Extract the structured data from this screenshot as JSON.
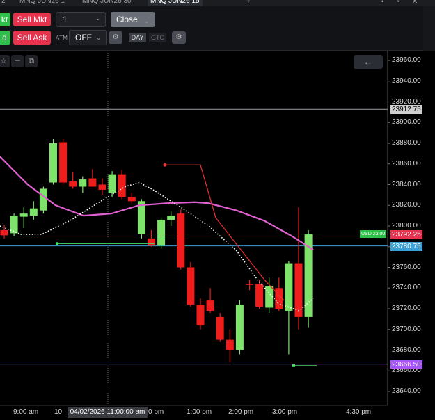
{
  "tabs": [
    {
      "label": "2"
    },
    {
      "label": "MNQ JUN26 1"
    },
    {
      "label": "MNQ JUN26 30"
    },
    {
      "label": "MNQ JUN26 15",
      "active": true
    }
  ],
  "tab_add": "+",
  "toolbar": {
    "buy_mkt": "kt",
    "sell_mkt": "Sell Mkt",
    "quantity": "1",
    "close": "Close",
    "buy_bid": "d",
    "sell_ask": "Sell Ask",
    "atm_label": "ATM",
    "atm_value": "OFF",
    "day": "DAY",
    "gtc": "GTC"
  },
  "chart_data": {
    "type": "candlestick",
    "y_range": [
      23630,
      23975
    ],
    "y_ticks": [
      "23960.00",
      "23940.00",
      "23920.00",
      "23900.00",
      "23880.00",
      "23860.00",
      "23840.00",
      "23820.00",
      "23800.00",
      "23780.00",
      "23760.00",
      "23740.00",
      "23720.00",
      "23700.00",
      "23680.00",
      "23660.00",
      "23640.00"
    ],
    "x_ticks": [
      "9:00 am",
      "10:",
      "0 pm",
      "1:00 pm",
      "2:00 pm",
      "3:00 pm",
      "4:30 pm"
    ],
    "crosshair_time": "04/02/2026 11:00:00 am",
    "price_lines": [
      {
        "label": "23912.75",
        "value": 23912.75,
        "color": "#9aa0a6"
      },
      {
        "label": "23792.25",
        "value": 23792.25,
        "color": "#e5334d"
      },
      {
        "label": "23780.75",
        "value": 23780.75,
        "color": "#3aa0d8"
      },
      {
        "label": "23666.50",
        "value": 23666.5,
        "color": "#a855f7"
      }
    ],
    "position_tag": "USD 23.00",
    "candles": [
      {
        "o": 23796,
        "h": 23801,
        "l": 23788,
        "c": 23791
      },
      {
        "o": 23793,
        "h": 23812,
        "l": 23790,
        "c": 23810
      },
      {
        "o": 23809,
        "h": 23818,
        "l": 23798,
        "c": 23812
      },
      {
        "o": 23810,
        "h": 23824,
        "l": 23806,
        "c": 23817
      },
      {
        "o": 23815,
        "h": 23838,
        "l": 23812,
        "c": 23836
      },
      {
        "o": 23842,
        "h": 23884,
        "l": 23840,
        "c": 23880
      },
      {
        "o": 23881,
        "h": 23884,
        "l": 23840,
        "c": 23842
      },
      {
        "o": 23843,
        "h": 23852,
        "l": 23836,
        "c": 23838
      },
      {
        "o": 23838,
        "h": 23848,
        "l": 23832,
        "c": 23845
      },
      {
        "o": 23846,
        "h": 23855,
        "l": 23838,
        "c": 23838
      },
      {
        "o": 23840,
        "h": 23846,
        "l": 23830,
        "c": 23835
      },
      {
        "o": 23832,
        "h": 23853,
        "l": 23828,
        "c": 23850
      },
      {
        "o": 23850,
        "h": 23854,
        "l": 23826,
        "c": 23828
      },
      {
        "o": 23828,
        "h": 23832,
        "l": 23822,
        "c": 23824
      },
      {
        "o": 23792,
        "h": 23826,
        "l": 23788,
        "c": 23824
      },
      {
        "o": 23788,
        "h": 23796,
        "l": 23780,
        "c": 23781
      },
      {
        "o": 23781,
        "h": 23808,
        "l": 23778,
        "c": 23806
      },
      {
        "o": 23806,
        "h": 23814,
        "l": 23800,
        "c": 23810
      },
      {
        "o": 23812,
        "h": 23816,
        "l": 23758,
        "c": 23760
      },
      {
        "o": 23760,
        "h": 23765,
        "l": 23722,
        "c": 23724
      },
      {
        "o": 23724,
        "h": 23730,
        "l": 23700,
        "c": 23704
      },
      {
        "o": 23728,
        "h": 23740,
        "l": 23716,
        "c": 23718
      },
      {
        "o": 23712,
        "h": 23716,
        "l": 23688,
        "c": 23690
      },
      {
        "o": 23690,
        "h": 23700,
        "l": 23668,
        "c": 23680
      },
      {
        "o": 23680,
        "h": 23728,
        "l": 23676,
        "c": 23724
      },
      {
        "o": 23744,
        "h": 23748,
        "l": 23738,
        "c": 23743
      },
      {
        "o": 23744,
        "h": 23748,
        "l": 23720,
        "c": 23722
      },
      {
        "o": 23721,
        "h": 23750,
        "l": 23716,
        "c": 23742
      },
      {
        "o": 23740,
        "h": 23750,
        "l": 23718,
        "c": 23720
      },
      {
        "o": 23718,
        "h": 23766,
        "l": 23676,
        "c": 23764
      },
      {
        "o": 23764,
        "h": 23818,
        "l": 23700,
        "c": 23712
      },
      {
        "o": 23712,
        "h": 23796,
        "l": 23702,
        "c": 23792
      }
    ],
    "magenta_ma": [
      [
        0,
        23867
      ],
      [
        40,
        23840
      ],
      [
        80,
        23820
      ],
      [
        120,
        23810
      ],
      [
        160,
        23812
      ],
      [
        200,
        23820
      ],
      [
        240,
        23822
      ],
      [
        280,
        23823
      ],
      [
        300,
        23822
      ],
      [
        340,
        23815
      ],
      [
        380,
        23805
      ],
      [
        420,
        23790
      ],
      [
        450,
        23777
      ]
    ],
    "white_dotted_ma": [
      [
        0,
        23800
      ],
      [
        30,
        23792
      ],
      [
        60,
        23792
      ],
      [
        100,
        23805
      ],
      [
        140,
        23822
      ],
      [
        180,
        23838
      ],
      [
        200,
        23842
      ],
      [
        220,
        23835
      ],
      [
        260,
        23818
      ],
      [
        300,
        23800
      ],
      [
        340,
        23776
      ],
      [
        370,
        23748
      ],
      [
        400,
        23725
      ],
      [
        430,
        23718
      ],
      [
        450,
        23730
      ]
    ],
    "red_stops": [
      [
        237,
        23859
      ],
      [
        288,
        23859
      ],
      [
        310,
        23808
      ],
      [
        380,
        23748
      ],
      [
        408,
        23728
      ]
    ],
    "green_targets": [
      [
        82,
        23783
      ],
      [
        222,
        23783
      ],
      [
        422,
        23665
      ],
      [
        455,
        23665
      ]
    ]
  },
  "icons": {
    "tool_1": "star-icon",
    "tool_2": "bar-chart-icon",
    "tool_3": "copy-icon",
    "back": "arrow-left-icon",
    "gear": "gear-icon"
  },
  "glyphs": {
    "star": "☆",
    "ruler": "⊢",
    "copy": "⧉",
    "gear": "⚙",
    "arrow_left": "←",
    "caret_down": "⌄"
  }
}
